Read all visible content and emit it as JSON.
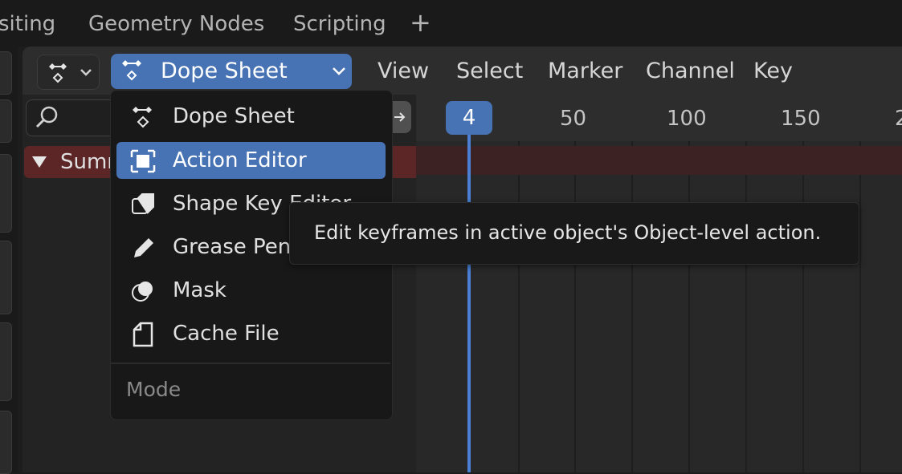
{
  "workspace_tabs": {
    "partial": "siting",
    "geometry_nodes": "Geometry Nodes",
    "scripting": "Scripting",
    "add": "+"
  },
  "header": {
    "editor_type": "Dope Sheet",
    "menus": [
      "View",
      "Select",
      "Marker",
      "Channel",
      "Key"
    ]
  },
  "channels": {
    "summary_label": "Summ"
  },
  "timeline": {
    "current_frame": "4",
    "ruler_labels": [
      "50",
      "100",
      "150",
      "2"
    ]
  },
  "dropdown": {
    "items": [
      {
        "label": "Dope Sheet",
        "icon": "dope-sheet-icon"
      },
      {
        "label": "Action Editor",
        "icon": "action-editor-icon"
      },
      {
        "label": "Shape Key Editor",
        "icon": "shape-key-icon"
      },
      {
        "label": "Grease Pencil",
        "icon": "pencil-icon"
      },
      {
        "label": "Mask",
        "icon": "mask-icon"
      },
      {
        "label": "Cache File",
        "icon": "file-icon"
      }
    ],
    "active_index": 1,
    "section_label": "Mode"
  },
  "tooltip": {
    "text": "Edit keyframes in active object's Object-level action."
  },
  "colors": {
    "accent": "#4772b3",
    "summary_red": "#5c2626",
    "background": "#1d1d1d"
  }
}
